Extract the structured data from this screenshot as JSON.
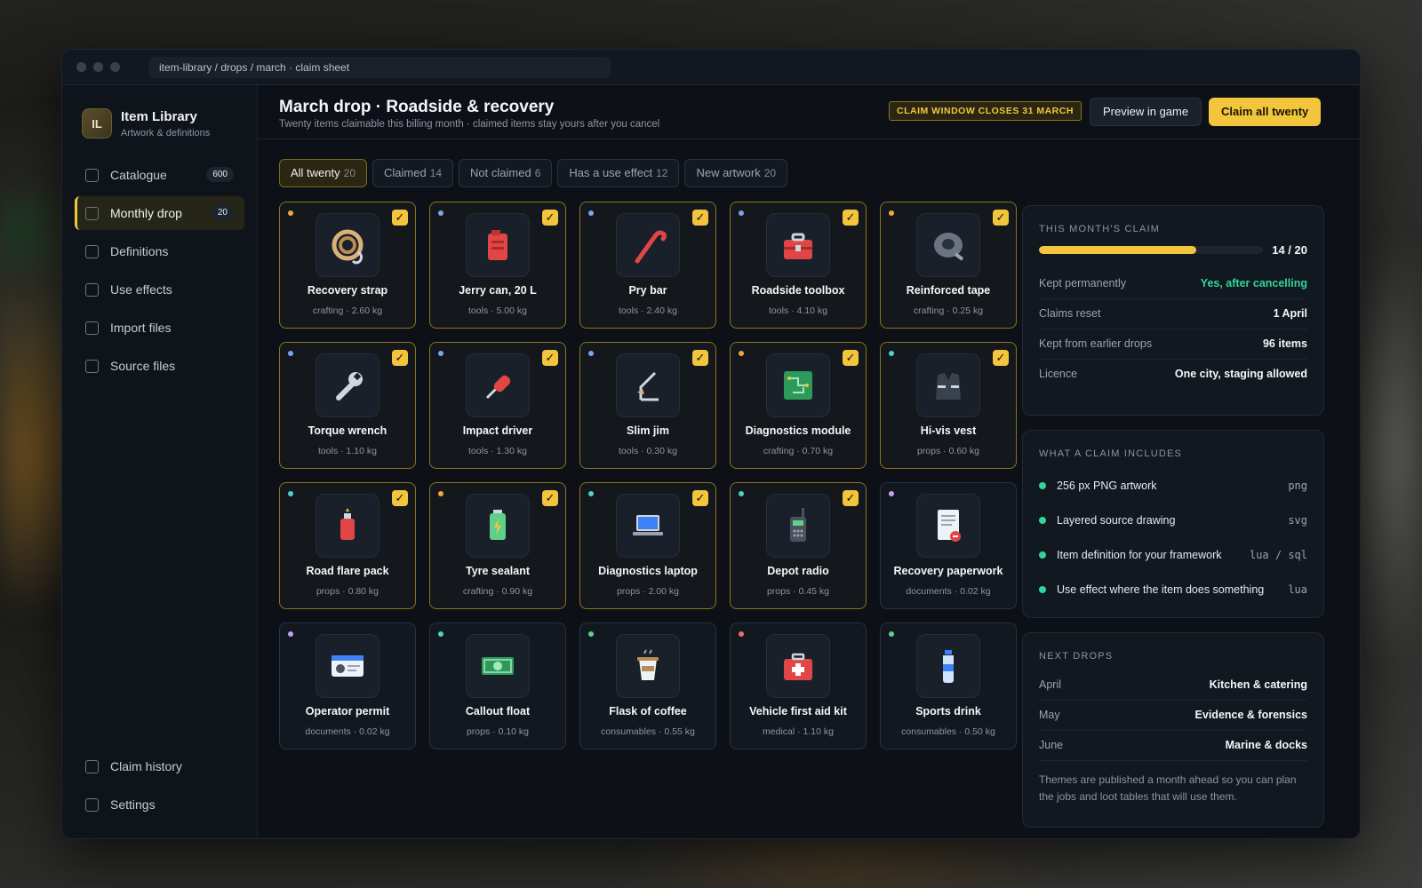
{
  "window": {
    "address": "item-library / drops / march · claim sheet"
  },
  "brand": {
    "initials": "IL",
    "title": "Item Library",
    "subtitle": "Artwork & definitions"
  },
  "sidebar": {
    "items": [
      {
        "label": "Catalogue",
        "badge": "600"
      },
      {
        "label": "Monthly drop",
        "badge": "20"
      },
      {
        "label": "Definitions"
      },
      {
        "label": "Use effects"
      },
      {
        "label": "Import files"
      },
      {
        "label": "Source files"
      }
    ],
    "bottom": [
      {
        "label": "Claim history"
      },
      {
        "label": "Settings"
      }
    ]
  },
  "header": {
    "title": "March drop · Roadside & recovery",
    "subtitle": "Twenty items claimable this billing month · claimed items stay yours after you cancel",
    "deadline": "CLAIM WINDOW CLOSES 31 MARCH",
    "preview_label": "Preview in game",
    "claim_label": "Claim all twenty"
  },
  "filters": [
    {
      "label": "All twenty",
      "count": "20"
    },
    {
      "label": "Claimed",
      "count": "14"
    },
    {
      "label": "Not claimed",
      "count": "6"
    },
    {
      "label": "Has a use effect",
      "count": "12"
    },
    {
      "label": "New artwork",
      "count": "20"
    }
  ],
  "items": [
    {
      "name": "Recovery strap",
      "meta": "crafting · 2.60 kg",
      "claimed": true,
      "dot": "#f0a83c",
      "icon": "rope-icon"
    },
    {
      "name": "Jerry can, 20 L",
      "meta": "tools · 5.00 kg",
      "claimed": true,
      "dot": "#7aa7f0",
      "icon": "jerry-can-icon"
    },
    {
      "name": "Pry bar",
      "meta": "tools · 2.40 kg",
      "claimed": true,
      "dot": "#7aa7f0",
      "icon": "crowbar-icon"
    },
    {
      "name": "Roadside toolbox",
      "meta": "tools · 4.10 kg",
      "claimed": true,
      "dot": "#7aa7f0",
      "icon": "toolbox-icon"
    },
    {
      "name": "Reinforced tape",
      "meta": "crafting · 0.25 kg",
      "claimed": true,
      "dot": "#f0a83c",
      "icon": "tape-icon"
    },
    {
      "name": "Torque wrench",
      "meta": "tools · 1.10 kg",
      "claimed": true,
      "dot": "#7aa7f0",
      "icon": "wrench-icon"
    },
    {
      "name": "Impact driver",
      "meta": "tools · 1.30 kg",
      "claimed": true,
      "dot": "#7aa7f0",
      "icon": "screwdriver-icon"
    },
    {
      "name": "Slim jim",
      "meta": "tools · 0.30 kg",
      "claimed": true,
      "dot": "#7aa7f0",
      "icon": "slim-jim-icon"
    },
    {
      "name": "Diagnostics module",
      "meta": "crafting · 0.70 kg",
      "claimed": true,
      "dot": "#f0a83c",
      "icon": "circuit-board-icon"
    },
    {
      "name": "Hi-vis vest",
      "meta": "props · 0.60 kg",
      "claimed": true,
      "dot": "#4fd1c5",
      "icon": "vest-icon"
    },
    {
      "name": "Road flare pack",
      "meta": "props · 0.80 kg",
      "claimed": true,
      "dot": "#4fd1c5",
      "icon": "flare-icon"
    },
    {
      "name": "Tyre sealant",
      "meta": "crafting · 0.90 kg",
      "claimed": true,
      "dot": "#f0a83c",
      "icon": "battery-icon"
    },
    {
      "name": "Diagnostics laptop",
      "meta": "props · 2.00 kg",
      "claimed": true,
      "dot": "#4fd1c5",
      "icon": "laptop-icon"
    },
    {
      "name": "Depot radio",
      "meta": "props · 0.45 kg",
      "claimed": true,
      "dot": "#4fd1c5",
      "icon": "radio-icon"
    },
    {
      "name": "Recovery paperwork",
      "meta": "documents · 0.02 kg",
      "claimed": false,
      "dot": "#c4a0f0",
      "icon": "document-icon"
    },
    {
      "name": "Operator permit",
      "meta": "documents · 0.02 kg",
      "claimed": false,
      "dot": "#c4a0f0",
      "icon": "id-card-icon"
    },
    {
      "name": "Callout float",
      "meta": "props · 0.10 kg",
      "claimed": false,
      "dot": "#4fd1c5",
      "icon": "banknote-icon"
    },
    {
      "name": "Flask of coffee",
      "meta": "consumables · 0.55 kg",
      "claimed": false,
      "dot": "#5fd08a",
      "icon": "coffee-icon"
    },
    {
      "name": "Vehicle first aid kit",
      "meta": "medical · 1.10 kg",
      "claimed": false,
      "dot": "#f06b6b",
      "icon": "first-aid-icon"
    },
    {
      "name": "Sports drink",
      "meta": "consumables · 0.50 kg",
      "claimed": false,
      "dot": "#5fd08a",
      "icon": "bottle-icon"
    }
  ],
  "claim_panel": {
    "title": "THIS MONTH'S CLAIM",
    "progress_label": "14 / 20",
    "progress_fraction": 0.7,
    "rows": [
      {
        "k": "Kept permanently",
        "v": "Yes, after cancelling"
      },
      {
        "k": "Claims reset",
        "v": "1 April"
      },
      {
        "k": "Kept from earlier drops",
        "v": "96 items"
      },
      {
        "k": "Licence",
        "v": "One city, staging allowed"
      }
    ]
  },
  "includes_panel": {
    "title": "WHAT A CLAIM INCLUDES",
    "rows": [
      {
        "label": "256 px PNG artwork",
        "ext": "png"
      },
      {
        "label": "Layered source drawing",
        "ext": "svg"
      },
      {
        "label": "Item definition for your framework",
        "ext": "lua / sql"
      },
      {
        "label": "Use effect where the item does something",
        "ext": "lua"
      }
    ]
  },
  "next_panel": {
    "title": "NEXT DROPS",
    "rows": [
      {
        "k": "April",
        "v": "Kitchen & catering"
      },
      {
        "k": "May",
        "v": "Evidence & forensics"
      },
      {
        "k": "June",
        "v": "Marine & docks"
      }
    ],
    "note": "Themes are published a month ahead so you can plan the jobs and loot tables that will use them."
  },
  "colors": {
    "accent": "#f2c53d",
    "success": "#34d399",
    "background": "#0d1117"
  }
}
